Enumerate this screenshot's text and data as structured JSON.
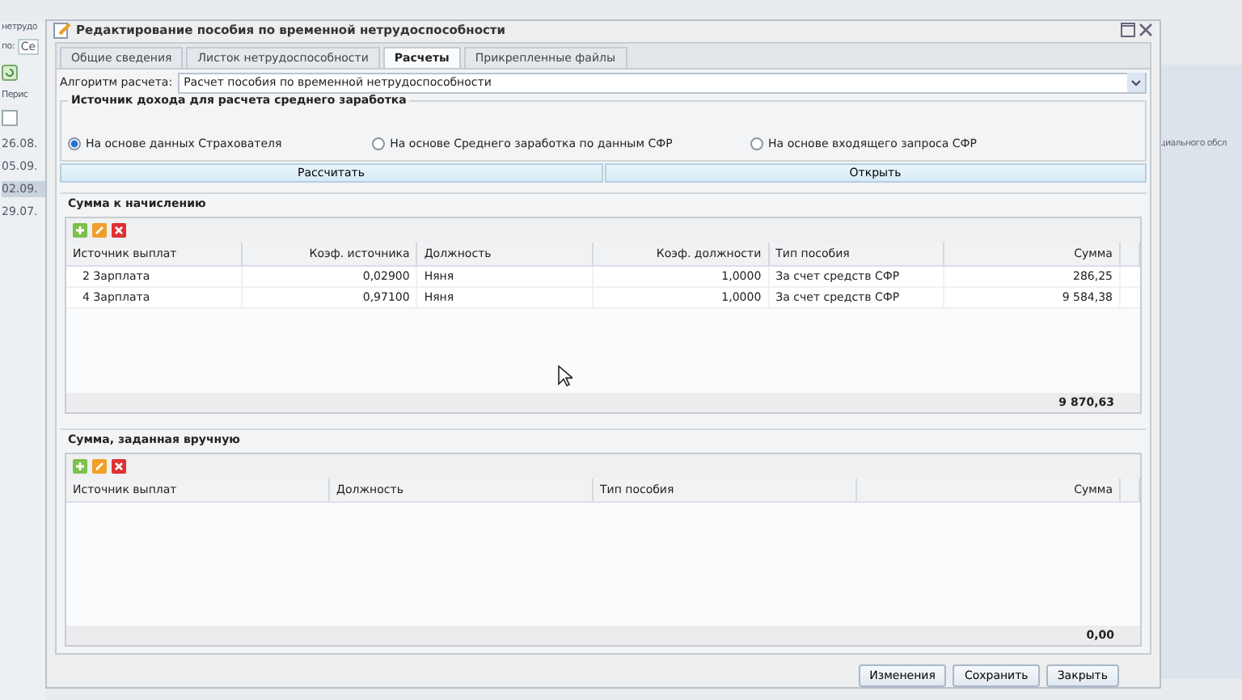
{
  "background": {
    "left_labels": [
      "нетрудо",
      "по:",
      "Перис"
    ],
    "filter_value": "Се",
    "dates": [
      {
        "text": "26.08.",
        "selected": false
      },
      {
        "text": "05.09.",
        "selected": false
      },
      {
        "text": "02.09.",
        "selected": true
      },
      {
        "text": "29.07.",
        "selected": false
      }
    ],
    "right_text": "циального обсл"
  },
  "dialog": {
    "title": "Редактирование пособия по временной нетрудоспособности",
    "tabs": [
      {
        "label": "Общие сведения",
        "selected": false
      },
      {
        "label": "Листок нетрудоспособности",
        "selected": false
      },
      {
        "label": "Расчеты",
        "selected": true
      },
      {
        "label": "Прикрепленные файлы",
        "selected": false
      }
    ],
    "algorithm": {
      "label": "Алгоритм расчета:",
      "value": "Расчет пособия по временной нетрудоспособности"
    },
    "income_source": {
      "legend": "Источник дохода для расчета среднего заработка",
      "options": [
        {
          "label": "На основе данных Страхователя",
          "selected": true
        },
        {
          "label": "На основе Среднего заработка по данным СФР",
          "selected": false
        },
        {
          "label": "На основе входящего запроса СФР",
          "selected": false
        }
      ]
    },
    "actions": [
      "Рассчитать",
      "Открыть"
    ],
    "accrual": {
      "title": "Сумма к начислению",
      "columns": [
        {
          "label": "Источник выплат",
          "kind": "text"
        },
        {
          "label": "Коэф. источника",
          "kind": "number"
        },
        {
          "label": "Должность",
          "kind": "text"
        },
        {
          "label": "Коэф. должности",
          "kind": "number"
        },
        {
          "label": "Тип пособия",
          "kind": "text"
        },
        {
          "label": "Сумма",
          "kind": "number"
        }
      ],
      "rows": [
        [
          "2 Зарплата",
          "0,02900",
          "Няня",
          "1,0000",
          "За счет средств СФР",
          "286,25"
        ],
        [
          "4 Зарплата",
          "0,97100",
          "Няня",
          "1,0000",
          "За счет средств СФР",
          "9 584,38"
        ]
      ],
      "total": "9 870,63"
    },
    "manual": {
      "title": "Сумма, заданная вручную",
      "columns": [
        {
          "label": "Источник выплат",
          "kind": "text"
        },
        {
          "label": "Должность",
          "kind": "text"
        },
        {
          "label": "Тип пособия",
          "kind": "text"
        },
        {
          "label": "Сумма",
          "kind": "number"
        }
      ],
      "total": "0,00"
    },
    "buttons": [
      "Изменения",
      "Сохранить",
      "Закрыть"
    ]
  }
}
